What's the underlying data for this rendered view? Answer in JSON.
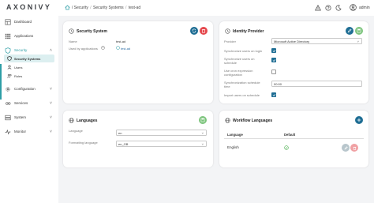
{
  "app": {
    "logo": "AXONIVY",
    "user": "admin"
  },
  "breadcrumb": {
    "items": [
      "Security",
      "Security Systems",
      "test-ad"
    ],
    "sep": "/"
  },
  "sidebar": {
    "items": [
      {
        "label": "Dashboard",
        "icon": "dashboard-icon"
      },
      {
        "label": "Applications",
        "icon": "applications-icon"
      },
      {
        "label": "Security",
        "icon": "security-icon",
        "expanded": true,
        "children": [
          {
            "label": "Security Systems",
            "icon": "security-systems-icon",
            "active": true
          },
          {
            "label": "Users",
            "icon": "users-icon"
          },
          {
            "label": "Roles",
            "icon": "roles-icon"
          }
        ]
      },
      {
        "label": "Configuration",
        "icon": "configuration-icon"
      },
      {
        "label": "Services",
        "icon": "services-icon"
      },
      {
        "label": "System",
        "icon": "system-icon"
      },
      {
        "label": "Monitor",
        "icon": "monitor-icon"
      }
    ]
  },
  "security_system": {
    "title": "Security System",
    "name_label": "Name",
    "name_value": "test-ad",
    "used_by_label": "Used by applications",
    "used_by_value": "test-ad"
  },
  "identity_provider": {
    "title": "Identity Provider",
    "provider_label": "Provider",
    "provider_value": "Microsoft Active Directory",
    "sync_login_label": "Synchronize users on login",
    "sync_login": true,
    "sync_schedule_label": "Synchronize users on schedule",
    "sync_schedule": true,
    "cron_label": "Use cron expression configuration",
    "cron": false,
    "schedule_time_label": "Synchronization schedule time",
    "schedule_time_value": "00:00",
    "import_label": "Import users on schedule",
    "import": true
  },
  "languages": {
    "title": "Languages",
    "language_label": "Language",
    "language_value": "en",
    "formatting_label": "Formatting language",
    "formatting_value": "en_GB"
  },
  "workflow_languages": {
    "title": "Workflow Languages",
    "col_language": "Language",
    "col_default": "Default",
    "rows": [
      {
        "language": "English",
        "default": true
      }
    ]
  },
  "colors": {
    "accent": "#2e9ea6",
    "blue_button": "#1f6e94",
    "green_button": "#7cc47c",
    "red_button": "#e5484d",
    "checkbox_on": "#1f6e94"
  }
}
